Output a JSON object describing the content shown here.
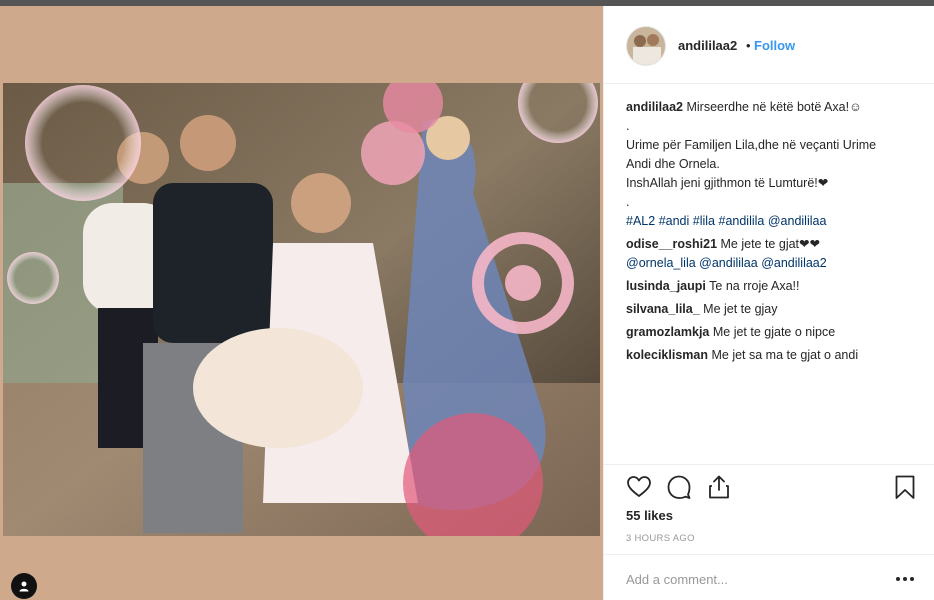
{
  "post": {
    "username": "andililaa2",
    "separator": "•",
    "follow_label": "Follow"
  },
  "caption": {
    "username": "andililaa2",
    "line1": "Mirseerdhe në këtë botë Axa!",
    "line1_emoji": "☺",
    "dot1": ".",
    "line2": "Urime për Familjen Lila,dhe në veçanti Urime",
    "line3": "Andi dhe Ornela.",
    "line4": "InshAllah jeni gjithmon të Lumturë!",
    "line4_emoji": "❤",
    "dot2": ".",
    "tags": [
      "#AL2",
      "#andi",
      "#lila",
      "#andilila",
      "@andililaa"
    ]
  },
  "comments": [
    {
      "username": "odise__roshi21",
      "text": "Me jete te gjat❤❤",
      "mentions": [
        "@ornela_lila",
        "@andililaa",
        "@andililaa2"
      ]
    },
    {
      "username": "lusinda_jaupi",
      "text": "Te na rroje Axa!!"
    },
    {
      "username": "silvana_lila_",
      "text": "Me jet te gjay"
    },
    {
      "username": "gramozlamkja",
      "text": "Me jet te gjate o nipce"
    },
    {
      "username": "koleciklisman",
      "text": "Me jet sa ma te gjat o andi"
    }
  ],
  "actions": {
    "like_icon": "heart-icon",
    "comment_icon": "comment-icon",
    "share_icon": "share-icon",
    "save_icon": "bookmark-icon"
  },
  "likes": "55 likes",
  "timestamp": "3 HOURS AGO",
  "add_comment": {
    "placeholder": "Add a comment...",
    "more_icon": "ellipsis-icon"
  },
  "colors": {
    "link": "#3897f0",
    "tag": "#003569",
    "muted": "#999999",
    "media_bg": "#cfa98b"
  }
}
